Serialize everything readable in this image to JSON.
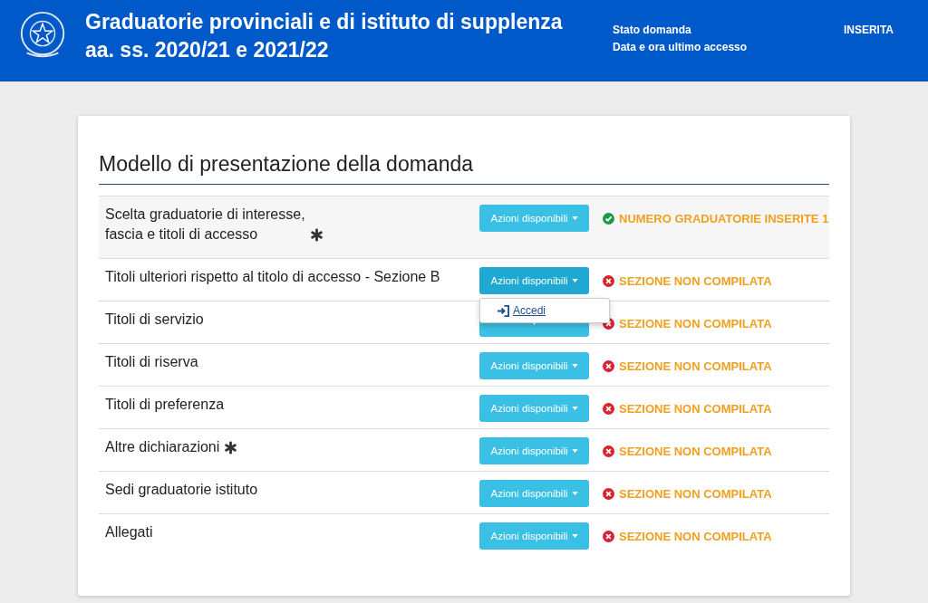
{
  "header": {
    "title_lines": [
      "Graduatorie provinciali e di istituto di supplenza",
      "aa. ss. 2020/21 e 2021/22"
    ],
    "info": [
      {
        "label": "Stato domanda",
        "value": "INSERITA"
      },
      {
        "label": "Data e ora ultimo accesso"
      }
    ]
  },
  "card": {
    "title": "Modello di presentazione della domanda",
    "rows": [
      {
        "label_lines": [
          "Scelta graduatorie di interesse,",
          "fascia e titoli di accesso"
        ],
        "required": true,
        "highlighted": true,
        "button": "Azioni disponibili",
        "menu_open": false,
        "kind": "ok",
        "status": "NUMERO GRADUATORIE INSERITE 1"
      },
      {
        "label_lines": [
          "Titoli ulteriori rispetto al titolo di accesso - Sezione B"
        ],
        "required": false,
        "highlighted": false,
        "button": "Azioni disponibili",
        "menu_open": true,
        "menu": [
          {
            "label": "Accedi"
          }
        ],
        "kind": "error",
        "status": "SEZIONE NON COMPILATA"
      },
      {
        "label_lines": [
          "Titoli di servizio"
        ],
        "required": false,
        "highlighted": false,
        "menu_open": false,
        "kind": "error",
        "status": "SEZIONE NON COMPILATA"
      },
      {
        "label_lines": [
          "Titoli di riserva"
        ],
        "required": false,
        "highlighted": false,
        "button": "Azioni disponibili",
        "menu_open": false,
        "kind": "error",
        "status": "SEZIONE NON COMPILATA"
      },
      {
        "label_lines": [
          "Titoli di preferenza"
        ],
        "required": false,
        "highlighted": false,
        "button": "Azioni disponibili",
        "menu_open": false,
        "kind": "error",
        "status": "SEZIONE NON COMPILATA"
      },
      {
        "label_lines": [
          "Altre dichiarazioni"
        ],
        "required": true,
        "highlighted": false,
        "button": "Azioni disponibili",
        "menu_open": false,
        "kind": "error",
        "status": "SEZIONE NON COMPILATA"
      },
      {
        "label_lines": [
          "Sedi graduatorie istituto"
        ],
        "required": false,
        "highlighted": false,
        "button": "Azioni disponibili",
        "menu_open": false,
        "kind": "error",
        "status": "SEZIONE NON COMPILATA"
      },
      {
        "label_lines": [
          "Allegati"
        ],
        "required": false,
        "highlighted": false,
        "button": "Azioni disponibili",
        "menu_open": false,
        "kind": "error",
        "status": "SEZIONE NON COMPILATA"
      }
    ]
  }
}
